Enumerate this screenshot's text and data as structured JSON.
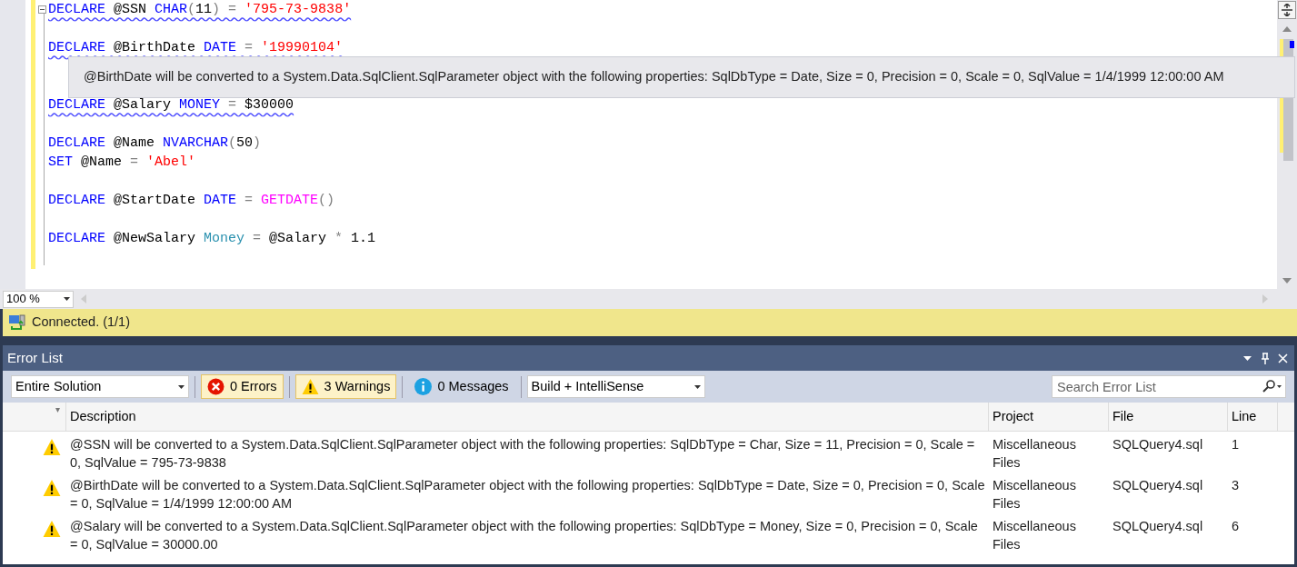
{
  "editor": {
    "lines": [
      {
        "kind": "code",
        "warning": true,
        "tokens": [
          {
            "text": "DECLARE",
            "kind": "keyword"
          },
          {
            "text": " @SSN ",
            "kind": "plain"
          },
          {
            "text": "CHAR",
            "kind": "keyword"
          },
          {
            "text": "(",
            "kind": "op"
          },
          {
            "text": "11",
            "kind": "plain"
          },
          {
            "text": ")",
            "kind": "op"
          },
          {
            "text": " = ",
            "kind": "op"
          },
          {
            "text": "'795-73-9838'",
            "kind": "string"
          }
        ]
      },
      {
        "kind": "blank"
      },
      {
        "kind": "code",
        "warning": true,
        "tokens": [
          {
            "text": "DECLARE",
            "kind": "keyword"
          },
          {
            "text": " @BirthDate ",
            "kind": "plain"
          },
          {
            "text": "DATE",
            "kind": "keyword"
          },
          {
            "text": " = ",
            "kind": "op"
          },
          {
            "text": "'19990104'",
            "kind": "string"
          }
        ]
      },
      {
        "kind": "blank"
      },
      {
        "kind": "blank"
      },
      {
        "kind": "code",
        "warning": true,
        "tokens": [
          {
            "text": "DECLARE",
            "kind": "keyword"
          },
          {
            "text": " @Salary ",
            "kind": "plain"
          },
          {
            "text": "MONEY",
            "kind": "keyword"
          },
          {
            "text": " = ",
            "kind": "op"
          },
          {
            "text": "$30000",
            "kind": "plain"
          }
        ]
      },
      {
        "kind": "blank"
      },
      {
        "kind": "code",
        "warning": false,
        "tokens": [
          {
            "text": "DECLARE",
            "kind": "keyword"
          },
          {
            "text": " @Name ",
            "kind": "plain"
          },
          {
            "text": "NVARCHAR",
            "kind": "keyword"
          },
          {
            "text": "(",
            "kind": "op"
          },
          {
            "text": "50",
            "kind": "plain"
          },
          {
            "text": ")",
            "kind": "op"
          }
        ]
      },
      {
        "kind": "code",
        "warning": false,
        "tokens": [
          {
            "text": "SET",
            "kind": "keyword"
          },
          {
            "text": " @Name ",
            "kind": "plain"
          },
          {
            "text": "= ",
            "kind": "op"
          },
          {
            "text": "'Abel'",
            "kind": "string"
          }
        ]
      },
      {
        "kind": "blank"
      },
      {
        "kind": "code",
        "warning": false,
        "tokens": [
          {
            "text": "DECLARE",
            "kind": "keyword"
          },
          {
            "text": " @StartDate ",
            "kind": "plain"
          },
          {
            "text": "DATE",
            "kind": "keyword"
          },
          {
            "text": " = ",
            "kind": "op"
          },
          {
            "text": "GETDATE",
            "kind": "function"
          },
          {
            "text": "()",
            "kind": "op"
          }
        ]
      },
      {
        "kind": "blank"
      },
      {
        "kind": "code",
        "warning": false,
        "tokens": [
          {
            "text": "DECLARE",
            "kind": "keyword"
          },
          {
            "text": " @NewSalary ",
            "kind": "plain"
          },
          {
            "text": "Money",
            "kind": "type"
          },
          {
            "text": " = ",
            "kind": "op"
          },
          {
            "text": "@Salary ",
            "kind": "plain"
          },
          {
            "text": "*",
            "kind": "op"
          },
          {
            "text": " 1.1",
            "kind": "plain"
          }
        ]
      }
    ],
    "tooltip": "@BirthDate will be converted to a System.Data.SqlClient.SqlParameter object with the following properties: SqlDbType = Date, Size = 0, Precision = 0, Scale = 0, SqlValue = 1/4/1999 12:00:00 AM",
    "zoom": "100 %"
  },
  "status_bar": {
    "text": "Connected. (1/1)"
  },
  "error_list": {
    "title": "Error List",
    "scope": "Entire Solution",
    "filters": [
      {
        "kind": "error",
        "label": "0 Errors",
        "selected": true
      },
      {
        "kind": "warning",
        "label": "3 Warnings",
        "selected": true
      },
      {
        "kind": "message",
        "label": "0 Messages",
        "selected": false
      }
    ],
    "source": "Build + IntelliSense",
    "search": {
      "placeholder": "Search Error List"
    },
    "columns": [
      "Description",
      "Project",
      "File",
      "Line"
    ],
    "rows": [
      {
        "kind": "warning",
        "description": "@SSN will be converted to a System.Data.SqlClient.SqlParameter object with the following properties: SqlDbType = Char, Size = 11, Precision = 0, Scale = 0, SqlValue = 795-73-9838",
        "project": "Miscellaneous Files",
        "file": "SQLQuery4.sql",
        "line": "1"
      },
      {
        "kind": "warning",
        "description": "@BirthDate will be converted to a System.Data.SqlClient.SqlParameter object with the following properties: SqlDbType = Date, Size = 0, Precision = 0, Scale = 0, SqlValue = 1/4/1999 12:00:00 AM",
        "project": "Miscellaneous Files",
        "file": "SQLQuery4.sql",
        "line": "3"
      },
      {
        "kind": "warning",
        "description": "@Salary will be converted to a System.Data.SqlClient.SqlParameter object with the following properties: SqlDbType = Money, Size = 0, Precision = 0, Scale = 0, SqlValue = 30000.00",
        "project": "Miscellaneous Files",
        "file": "SQLQuery4.sql",
        "line": "6"
      }
    ]
  }
}
